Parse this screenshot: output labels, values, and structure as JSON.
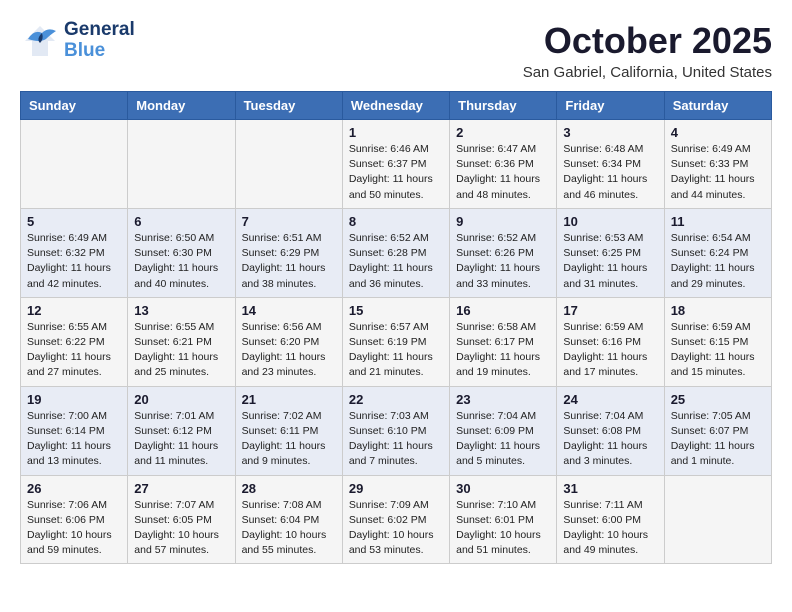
{
  "header": {
    "logo_general": "General",
    "logo_blue": "Blue",
    "month_title": "October 2025",
    "location": "San Gabriel, California, United States"
  },
  "days_of_week": [
    "Sunday",
    "Monday",
    "Tuesday",
    "Wednesday",
    "Thursday",
    "Friday",
    "Saturday"
  ],
  "weeks": [
    [
      {
        "day": "",
        "info": ""
      },
      {
        "day": "",
        "info": ""
      },
      {
        "day": "",
        "info": ""
      },
      {
        "day": "1",
        "info": "Sunrise: 6:46 AM\nSunset: 6:37 PM\nDaylight: 11 hours\nand 50 minutes."
      },
      {
        "day": "2",
        "info": "Sunrise: 6:47 AM\nSunset: 6:36 PM\nDaylight: 11 hours\nand 48 minutes."
      },
      {
        "day": "3",
        "info": "Sunrise: 6:48 AM\nSunset: 6:34 PM\nDaylight: 11 hours\nand 46 minutes."
      },
      {
        "day": "4",
        "info": "Sunrise: 6:49 AM\nSunset: 6:33 PM\nDaylight: 11 hours\nand 44 minutes."
      }
    ],
    [
      {
        "day": "5",
        "info": "Sunrise: 6:49 AM\nSunset: 6:32 PM\nDaylight: 11 hours\nand 42 minutes."
      },
      {
        "day": "6",
        "info": "Sunrise: 6:50 AM\nSunset: 6:30 PM\nDaylight: 11 hours\nand 40 minutes."
      },
      {
        "day": "7",
        "info": "Sunrise: 6:51 AM\nSunset: 6:29 PM\nDaylight: 11 hours\nand 38 minutes."
      },
      {
        "day": "8",
        "info": "Sunrise: 6:52 AM\nSunset: 6:28 PM\nDaylight: 11 hours\nand 36 minutes."
      },
      {
        "day": "9",
        "info": "Sunrise: 6:52 AM\nSunset: 6:26 PM\nDaylight: 11 hours\nand 33 minutes."
      },
      {
        "day": "10",
        "info": "Sunrise: 6:53 AM\nSunset: 6:25 PM\nDaylight: 11 hours\nand 31 minutes."
      },
      {
        "day": "11",
        "info": "Sunrise: 6:54 AM\nSunset: 6:24 PM\nDaylight: 11 hours\nand 29 minutes."
      }
    ],
    [
      {
        "day": "12",
        "info": "Sunrise: 6:55 AM\nSunset: 6:22 PM\nDaylight: 11 hours\nand 27 minutes."
      },
      {
        "day": "13",
        "info": "Sunrise: 6:55 AM\nSunset: 6:21 PM\nDaylight: 11 hours\nand 25 minutes."
      },
      {
        "day": "14",
        "info": "Sunrise: 6:56 AM\nSunset: 6:20 PM\nDaylight: 11 hours\nand 23 minutes."
      },
      {
        "day": "15",
        "info": "Sunrise: 6:57 AM\nSunset: 6:19 PM\nDaylight: 11 hours\nand 21 minutes."
      },
      {
        "day": "16",
        "info": "Sunrise: 6:58 AM\nSunset: 6:17 PM\nDaylight: 11 hours\nand 19 minutes."
      },
      {
        "day": "17",
        "info": "Sunrise: 6:59 AM\nSunset: 6:16 PM\nDaylight: 11 hours\nand 17 minutes."
      },
      {
        "day": "18",
        "info": "Sunrise: 6:59 AM\nSunset: 6:15 PM\nDaylight: 11 hours\nand 15 minutes."
      }
    ],
    [
      {
        "day": "19",
        "info": "Sunrise: 7:00 AM\nSunset: 6:14 PM\nDaylight: 11 hours\nand 13 minutes."
      },
      {
        "day": "20",
        "info": "Sunrise: 7:01 AM\nSunset: 6:12 PM\nDaylight: 11 hours\nand 11 minutes."
      },
      {
        "day": "21",
        "info": "Sunrise: 7:02 AM\nSunset: 6:11 PM\nDaylight: 11 hours\nand 9 minutes."
      },
      {
        "day": "22",
        "info": "Sunrise: 7:03 AM\nSunset: 6:10 PM\nDaylight: 11 hours\nand 7 minutes."
      },
      {
        "day": "23",
        "info": "Sunrise: 7:04 AM\nSunset: 6:09 PM\nDaylight: 11 hours\nand 5 minutes."
      },
      {
        "day": "24",
        "info": "Sunrise: 7:04 AM\nSunset: 6:08 PM\nDaylight: 11 hours\nand 3 minutes."
      },
      {
        "day": "25",
        "info": "Sunrise: 7:05 AM\nSunset: 6:07 PM\nDaylight: 11 hours\nand 1 minute."
      }
    ],
    [
      {
        "day": "26",
        "info": "Sunrise: 7:06 AM\nSunset: 6:06 PM\nDaylight: 10 hours\nand 59 minutes."
      },
      {
        "day": "27",
        "info": "Sunrise: 7:07 AM\nSunset: 6:05 PM\nDaylight: 10 hours\nand 57 minutes."
      },
      {
        "day": "28",
        "info": "Sunrise: 7:08 AM\nSunset: 6:04 PM\nDaylight: 10 hours\nand 55 minutes."
      },
      {
        "day": "29",
        "info": "Sunrise: 7:09 AM\nSunset: 6:02 PM\nDaylight: 10 hours\nand 53 minutes."
      },
      {
        "day": "30",
        "info": "Sunrise: 7:10 AM\nSunset: 6:01 PM\nDaylight: 10 hours\nand 51 minutes."
      },
      {
        "day": "31",
        "info": "Sunrise: 7:11 AM\nSunset: 6:00 PM\nDaylight: 10 hours\nand 49 minutes."
      },
      {
        "day": "",
        "info": ""
      }
    ]
  ]
}
